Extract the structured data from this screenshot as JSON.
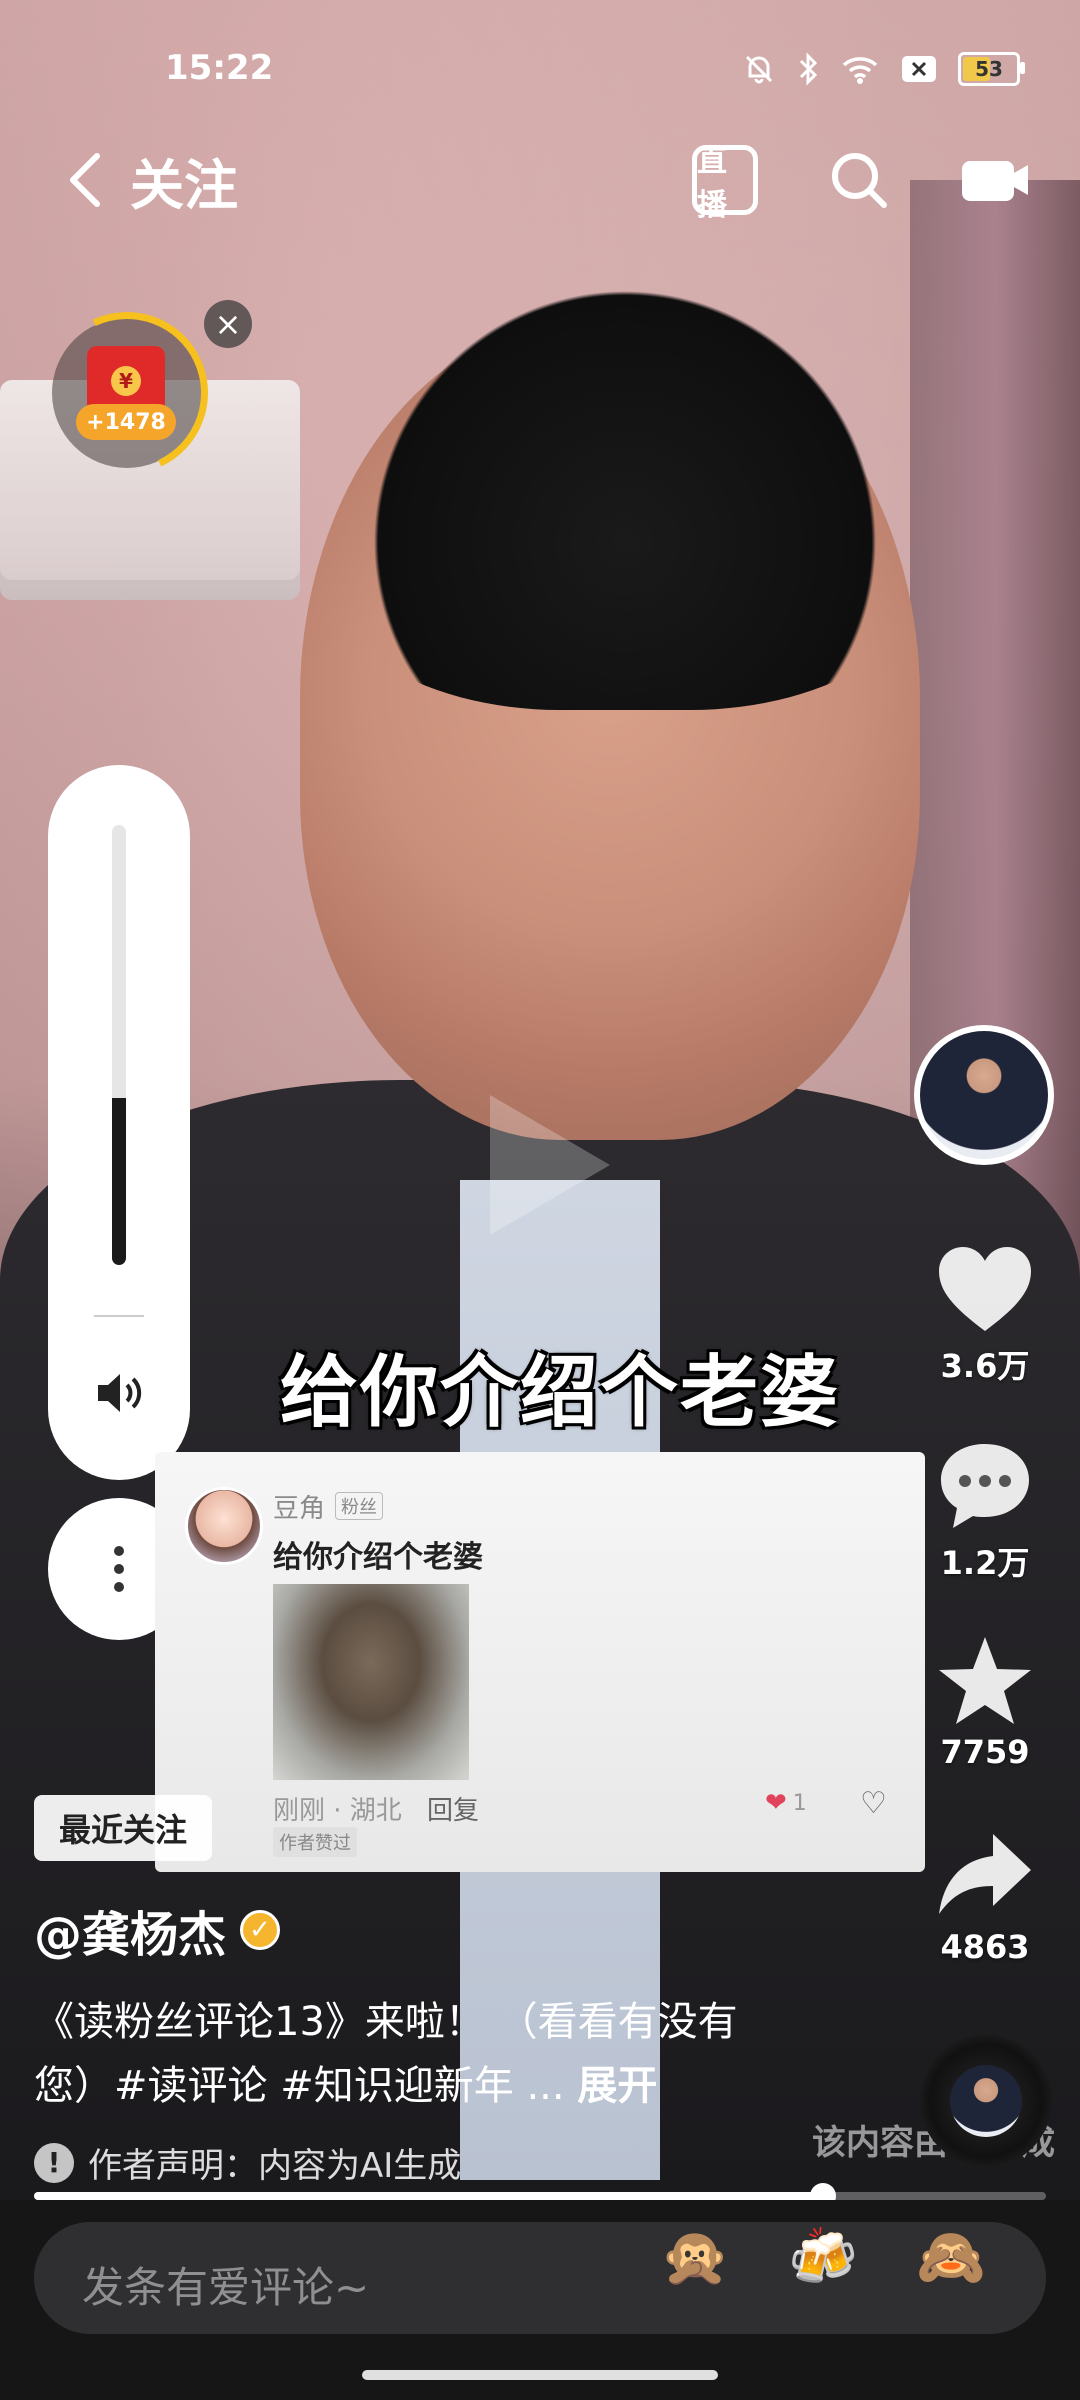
{
  "status_bar": {
    "time": "15:22",
    "battery": "53",
    "battery_level": 0.53
  },
  "nav": {
    "title": "关注",
    "live_label": "直播"
  },
  "reward": {
    "badge": "+1478",
    "coin_symbol": "¥"
  },
  "volume": {
    "level": 0.38
  },
  "video": {
    "caption": "给你介绍个老婆",
    "watermark": "该内容由AI生成"
  },
  "comment_card": {
    "user": "豆角",
    "fan_tag": "粉丝",
    "text": "给你介绍个老婆",
    "meta": "刚刚 · 湖北",
    "reply": "回复",
    "author_liked": "作者赞过",
    "like_count": "1"
  },
  "rail": {
    "likes": "3.6万",
    "comments": "1.2万",
    "favorites": "7759",
    "shares": "4863"
  },
  "recent_follow_label": "最近关注",
  "author": {
    "name": "@龚杨杰"
  },
  "description": {
    "text": "《读粉丝评论13》来啦！ （看看有没有您）#读评论 #知识迎新年 ...",
    "expand": "展开"
  },
  "disclaimer": "作者声明：内容为AI生成",
  "progress": {
    "fraction": 0.78
  },
  "comment_bar": {
    "placeholder": "发条有爱评论~",
    "emojis": [
      "🙊",
      "🍻",
      "🙈"
    ]
  },
  "colors": {
    "accent_yellow": "#f6c01e",
    "like_red": "#e0435b",
    "bar_bg": "#161616"
  }
}
